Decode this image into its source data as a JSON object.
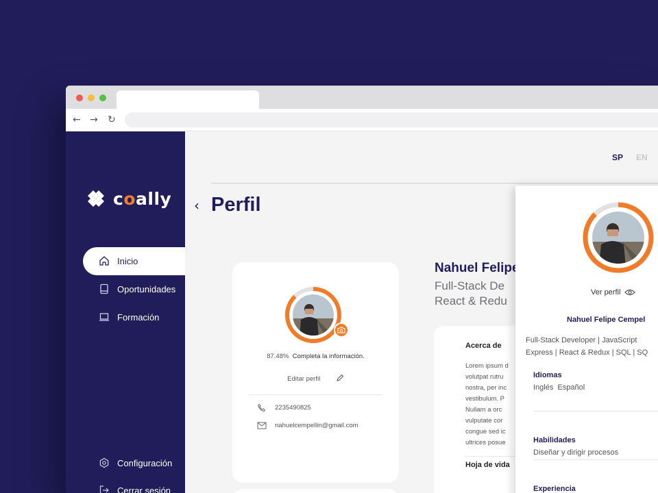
{
  "brand": {
    "logo_prefix": "c",
    "logo_o": "o",
    "logo_suffix": "ally"
  },
  "sidebar": {
    "items": [
      {
        "label": "Inicio",
        "icon": "home-icon"
      },
      {
        "label": "Oportunidades",
        "icon": "tablet-icon"
      },
      {
        "label": "Formación",
        "icon": "laptop-icon"
      }
    ],
    "bottom_items": [
      {
        "label": "Configuración",
        "icon": "gear-icon"
      },
      {
        "label": "Cerrar sesión",
        "icon": "logout-icon"
      }
    ]
  },
  "header": {
    "lang_sp": "SP",
    "lang_en": "EN",
    "page_title": "Perfil"
  },
  "profile_card": {
    "completion_pct": "87.48%",
    "completion_value": 87.48,
    "completion_text": "Completa la información.",
    "edit_label": "Editar perfil",
    "phone": "2235490825",
    "email": "nahuelcempellin@gmail.com"
  },
  "profile_main": {
    "name": "Nahuel Felipe",
    "subtitle_line1": "Full-Stack De",
    "subtitle_line2": "React & Redu"
  },
  "about": {
    "title": "Acerca de",
    "lines": [
      "Lorem ipsum d",
      "volutpat rutru",
      "nostra, per inc",
      "vestibulum. P",
      "Nullam a orc",
      "vulputate cor",
      "congue sed ic",
      "ultrices posue"
    ],
    "cv_title": "Hoja de vida"
  },
  "preview_panel": {
    "view_label": "Ver perfil",
    "name": "Nahuel Felipe Cempel",
    "desc_line1": "Full-Stack Developer | JavaScript",
    "desc_line2": "Express | React & Redux | SQL | SQ",
    "languages_title": "Idiomas",
    "languages": "Inglés  Español",
    "skills_title": "Habilidades",
    "skills": "Diseñar y dirigir procesos",
    "experience_title": "Experiencia"
  },
  "colors": {
    "navy": "#211d5a",
    "orange": "#f07c2a",
    "ring_track": "#e1e1e1"
  }
}
